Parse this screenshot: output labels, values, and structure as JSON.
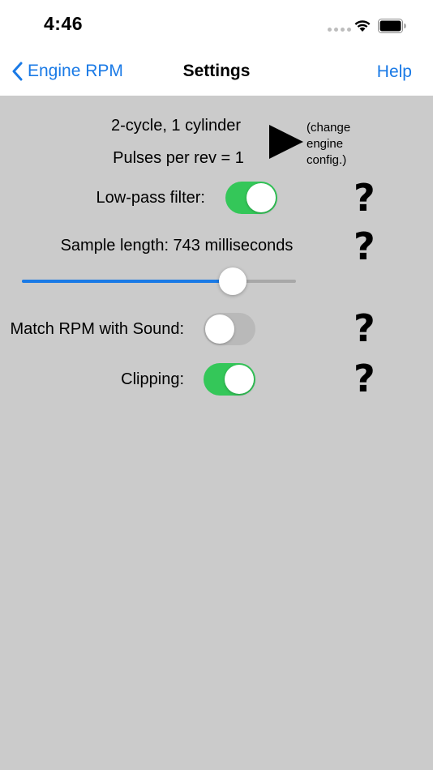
{
  "status_bar": {
    "time": "4:46"
  },
  "nav": {
    "back_label": "Engine RPM",
    "title": "Settings",
    "help_label": "Help"
  },
  "engine": {
    "config": "2-cycle, 1 cylinder",
    "pulses": "Pulses per rev = 1",
    "change_line1": "(change",
    "change_line2": "engine",
    "change_line3": "config.)"
  },
  "low_pass": {
    "label": "Low-pass filter:",
    "on": true
  },
  "sample": {
    "label": "Sample length: 743 milliseconds",
    "slider_fraction": 0.77
  },
  "match_rpm": {
    "label": "Match RPM with Sound:",
    "on": false
  },
  "clipping": {
    "label": "Clipping:",
    "on": true
  },
  "help_glyph": "?",
  "colors": {
    "accent": "#1a7ae6",
    "toggle_on": "#34c759",
    "background": "#cbcbcb"
  }
}
